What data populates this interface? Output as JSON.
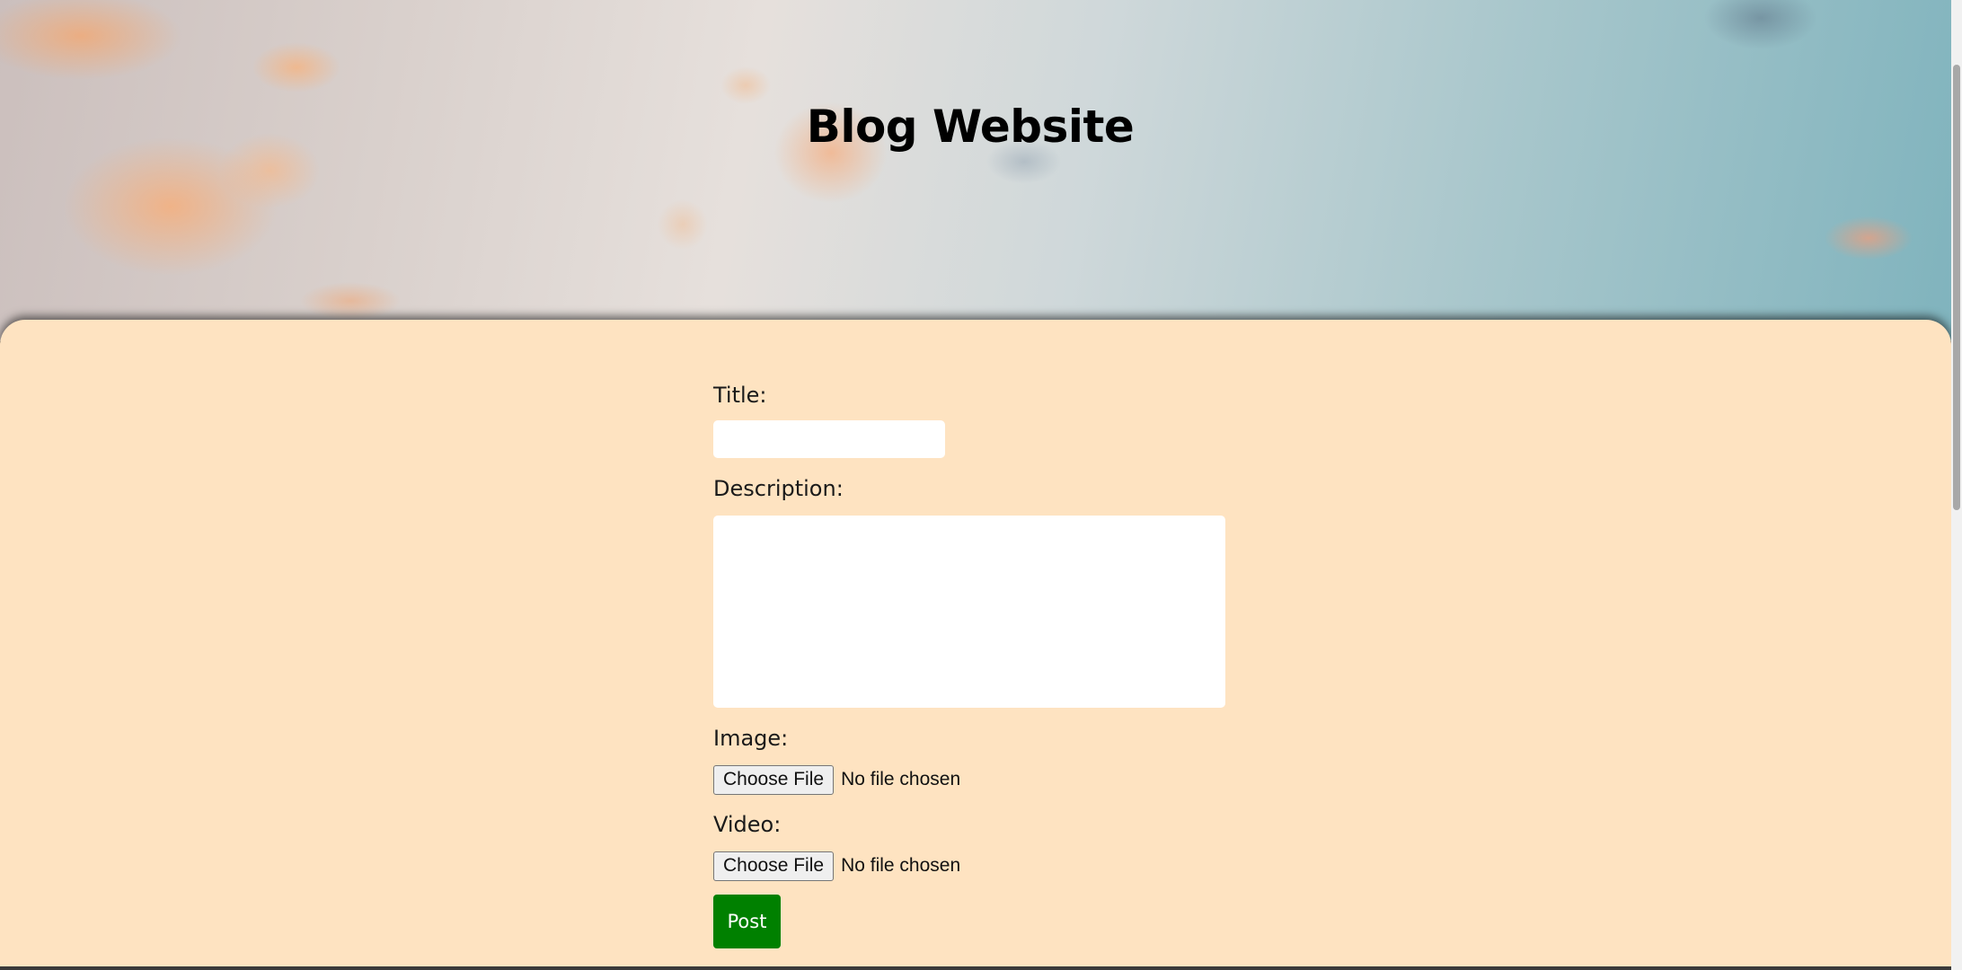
{
  "header": {
    "title": "Blog Website"
  },
  "form": {
    "title_label": "Title:",
    "title_value": "",
    "description_label": "Description:",
    "description_value": "",
    "image_label": "Image:",
    "image_button": "Choose File",
    "image_status": "No file chosen",
    "video_label": "Video:",
    "video_button": "Choose File",
    "video_status": "No file chosen",
    "post_button": "Post"
  },
  "colors": {
    "panel_background": "#fee3c1",
    "post_button": "#008000",
    "title_text": "#000000"
  }
}
